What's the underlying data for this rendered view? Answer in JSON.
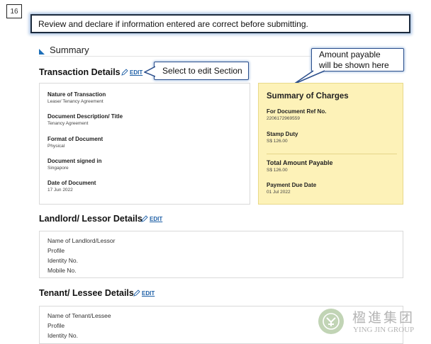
{
  "step_number": "16",
  "instruction": "Review and declare if information entered are correct before submitting.",
  "summary_heading": "Summary",
  "transaction": {
    "title": "Transaction Details",
    "edit_label": "EDIT",
    "fields": [
      {
        "label": "Nature of Transaction",
        "value": "Lease/ Tenancy Agreement"
      },
      {
        "label": "Document Description/ Title",
        "value": "Tenancy Agreement"
      },
      {
        "label": "Format of Document",
        "value": "Physical"
      },
      {
        "label": "Document signed in",
        "value": "Singapore"
      },
      {
        "label": "Date of Document",
        "value": "17 Jun 2022"
      }
    ]
  },
  "callouts": {
    "edit": "Select to edit Section",
    "payable_line1": "Amount payable",
    "payable_line2": "will be shown here"
  },
  "charges": {
    "title": "Summary of Charges",
    "doc_ref_label": "For Document Ref No.",
    "doc_ref_value": "2206172969559",
    "stamp_duty_label": "Stamp Duty",
    "stamp_duty_value": "S$ 126.00",
    "total_label": "Total Amount Payable",
    "total_value": "S$ 126.00",
    "due_label": "Payment Due Date",
    "due_value": "01 Jul 2022"
  },
  "landlord": {
    "title": "Landlord/ Lessor Details",
    "edit_label": "EDIT",
    "lines": [
      "Name of Landlord/Lessor",
      "Profile",
      "Identity No.",
      "Mobile No."
    ]
  },
  "tenant": {
    "title": "Tenant/ Lessee Details",
    "edit_label": "EDIT",
    "lines": [
      "Name of Tenant/Lessee",
      "Profile",
      "Identity No."
    ]
  },
  "watermark": {
    "chinese": "楹進集团",
    "english": "YING JIN GROUP"
  },
  "colors": {
    "link": "#1d5fa6",
    "charges_bg": "#fdf2b8",
    "callout_border": "#2c4f8c"
  }
}
